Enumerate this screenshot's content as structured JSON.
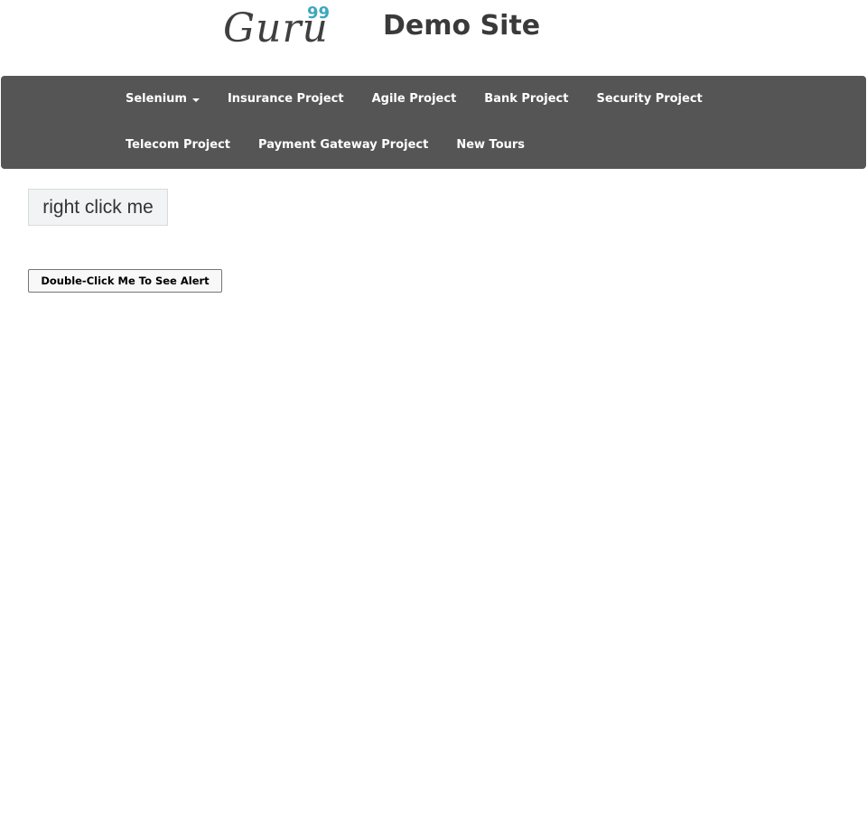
{
  "header": {
    "logo_word": "Guru",
    "logo_superscript": "99",
    "site_title": "Demo Site"
  },
  "nav": {
    "row1": [
      {
        "label": "Selenium",
        "has_dropdown": true
      },
      {
        "label": "Insurance Project"
      },
      {
        "label": "Agile Project"
      },
      {
        "label": "Bank Project"
      },
      {
        "label": "Security Project"
      }
    ],
    "row2": [
      {
        "label": "Telecom Project"
      },
      {
        "label": "Payment Gateway Project"
      },
      {
        "label": "New Tours"
      }
    ]
  },
  "main": {
    "right_click_label": "right click me",
    "double_click_label": "Double-Click Me To See Alert"
  },
  "colors": {
    "navbar_bg": "#555555",
    "logo_accent": "#3ea7bd",
    "title_text": "#3a3a3a"
  },
  "icons": {
    "dropdown": "caret-down-icon"
  }
}
